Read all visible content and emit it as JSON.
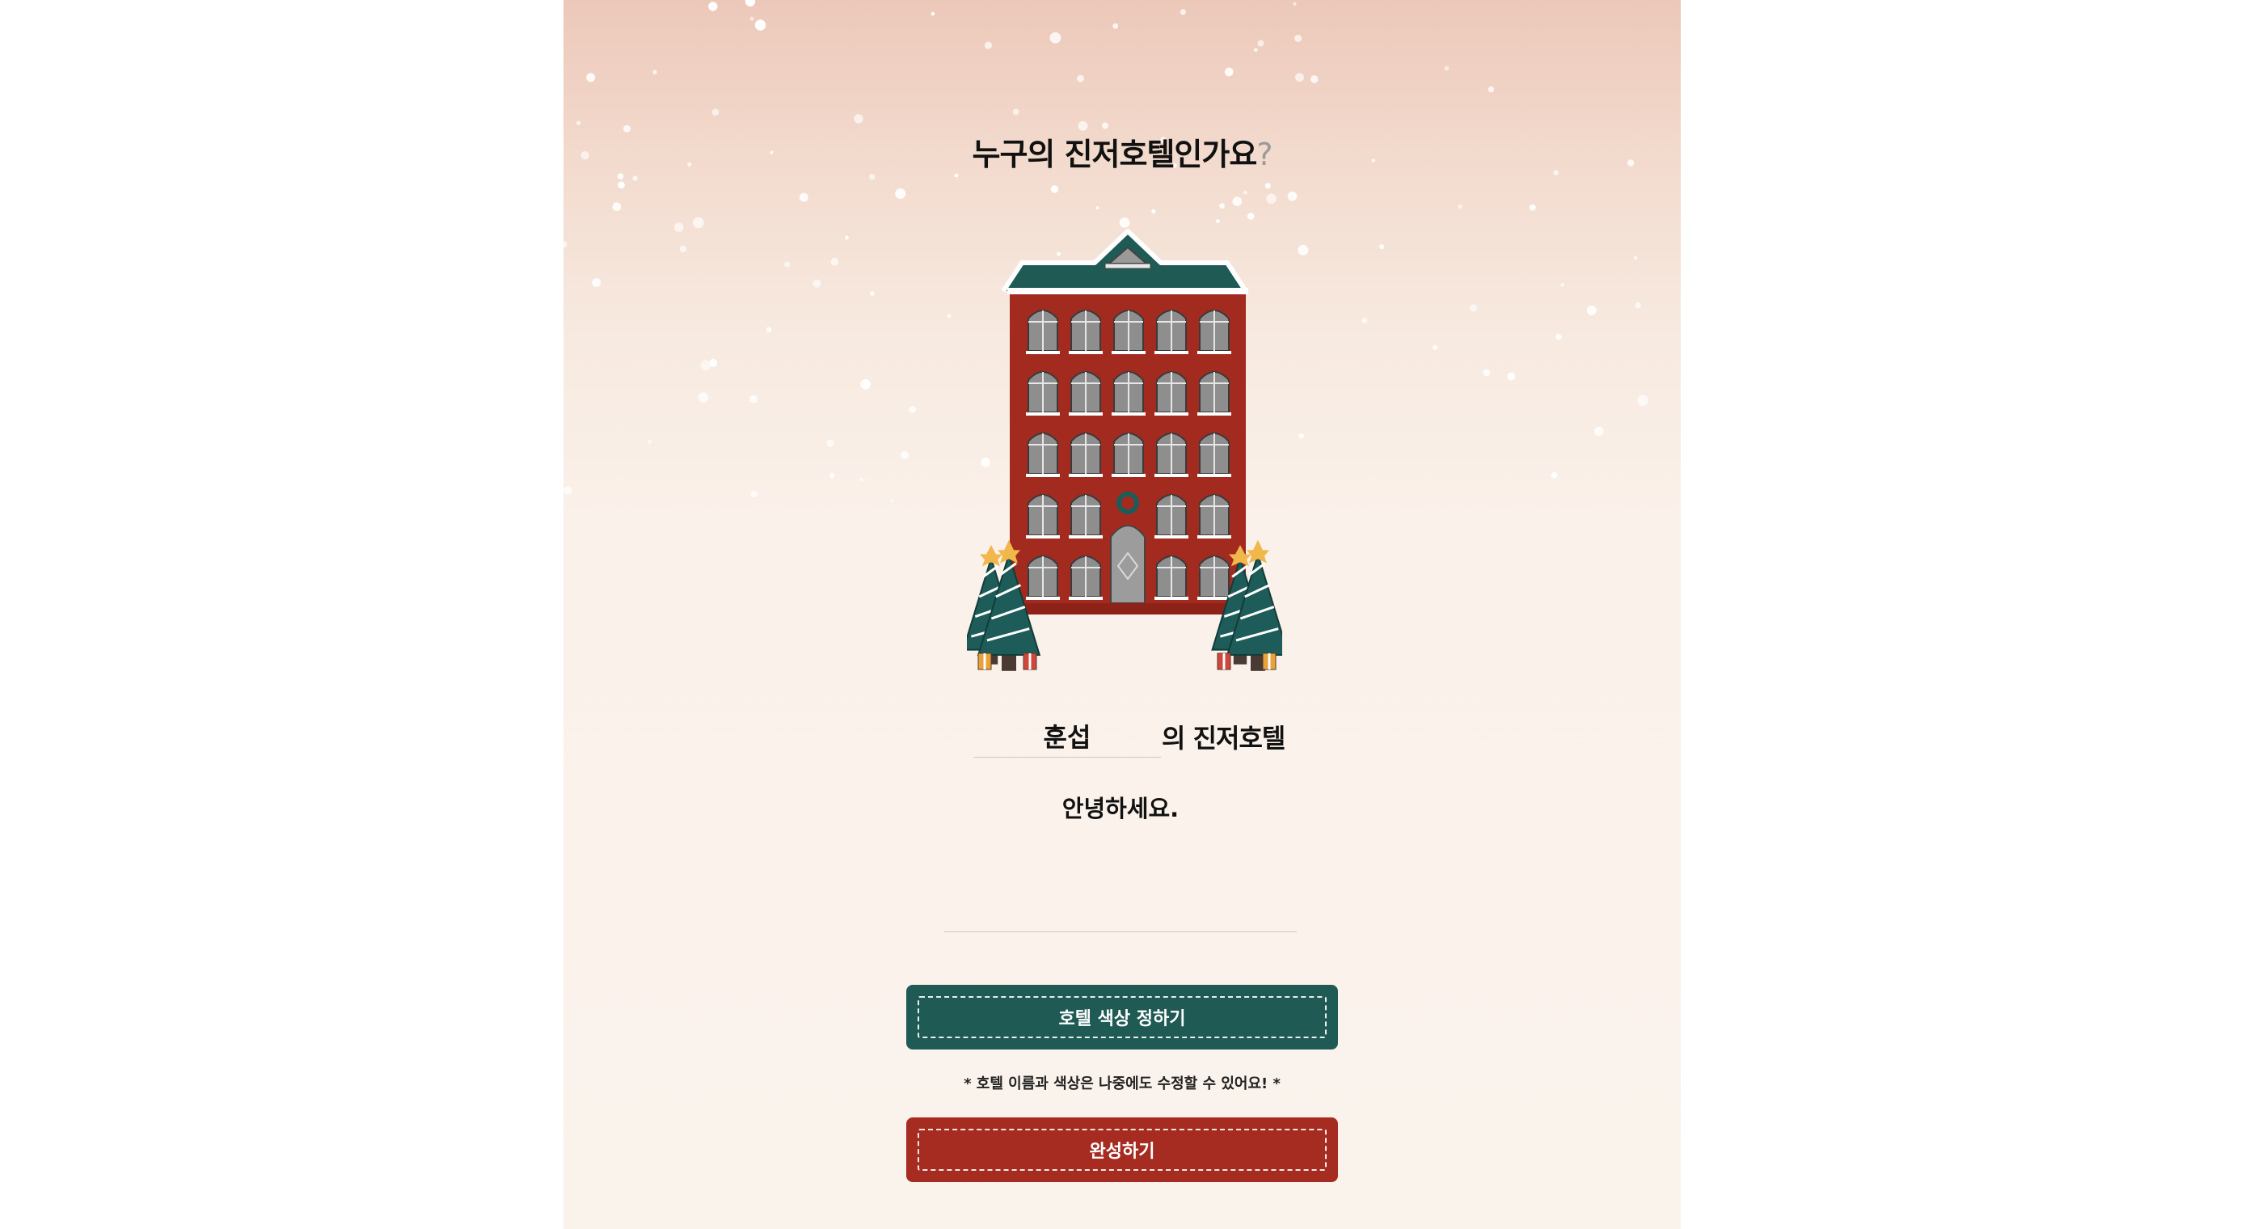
{
  "page": {
    "title_main": "누구의 진저호텔인가요",
    "title_mark": "?"
  },
  "hotel": {
    "name_value": "훈섭",
    "name_suffix": "의 진저호텔",
    "message_value": "안녕하세요."
  },
  "buttons": {
    "choose_color_label": "호텔 색상 정하기",
    "complete_label": "완성하기"
  },
  "notice": "* 호텔 이름과 색상은 나중에도 수정할 수 있어요! *",
  "colors": {
    "brick": "#a32a1f",
    "roof": "#1f5a55",
    "tree": "#1d5c58",
    "snow": "#ffffff",
    "window": "#8e8e8e"
  },
  "icons": [
    "hotel-building-icon",
    "christmas-tree-icon",
    "wreath-icon",
    "gift-box-icon",
    "star-icon"
  ]
}
